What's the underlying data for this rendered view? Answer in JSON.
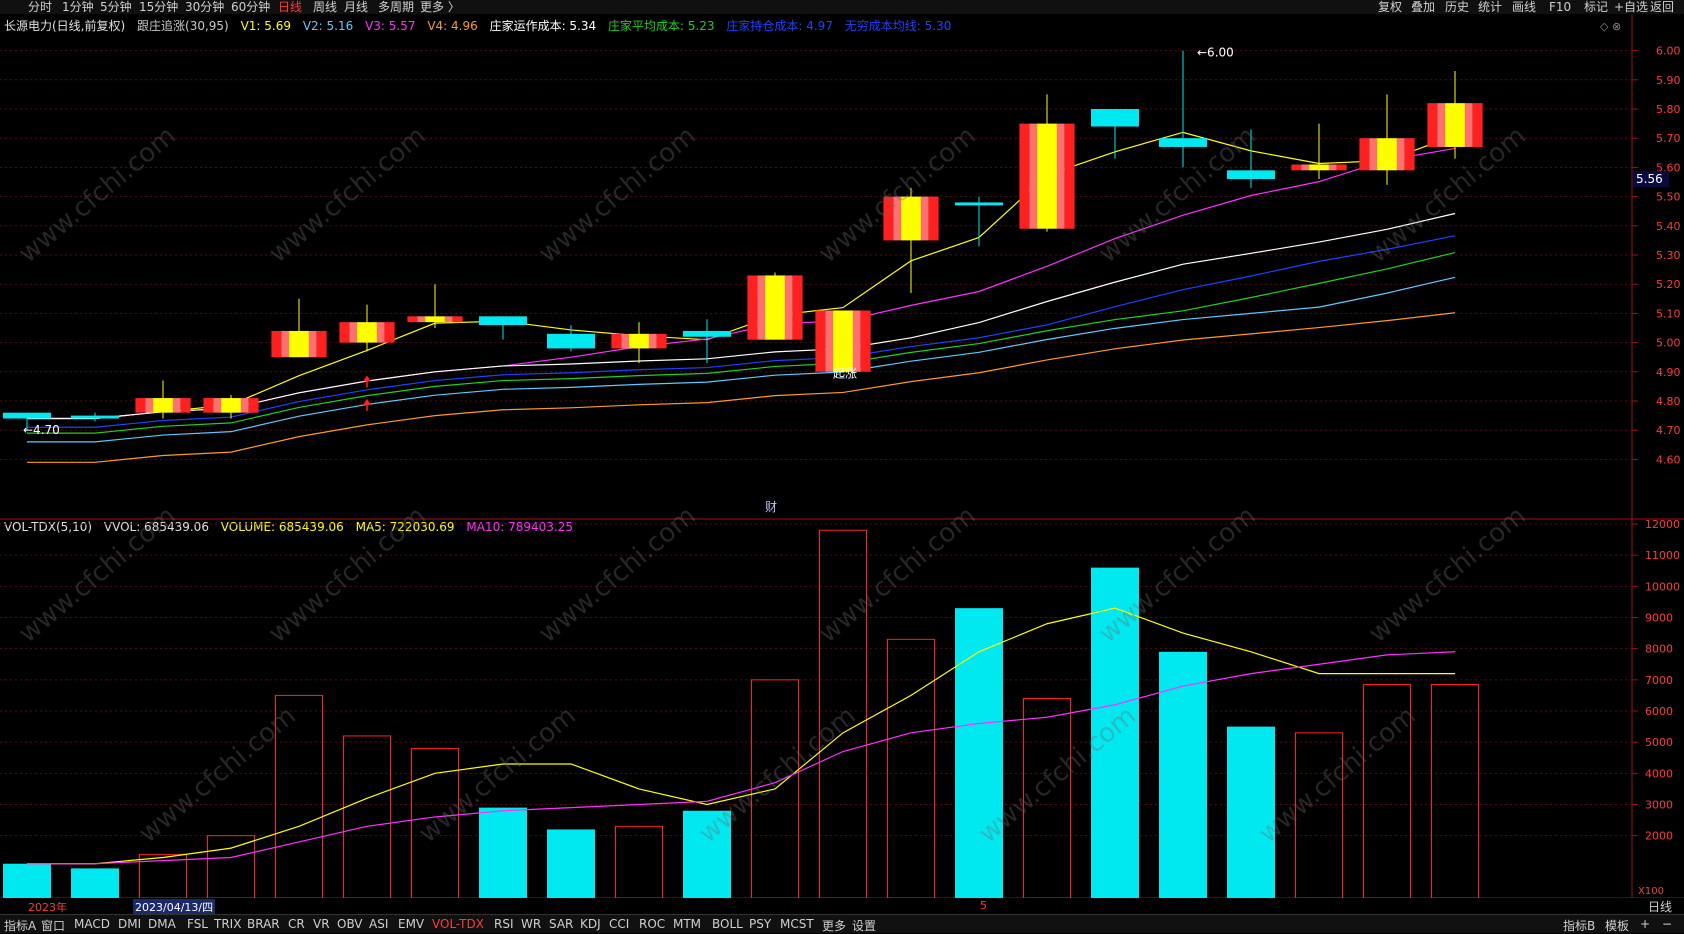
{
  "topbar": {
    "left_items": [
      "分时",
      "1分钟",
      "5分钟",
      "15分钟",
      "30分钟",
      "60分钟",
      "日线",
      "周线",
      "月线",
      "多周期",
      "更多 〉"
    ],
    "active": "日线",
    "right_items": [
      "复权",
      "叠加",
      "历史",
      "统计",
      "画线",
      "F10",
      "标记",
      "+自选",
      "返回"
    ]
  },
  "info": {
    "stock": "长源电力(日线,前复权)",
    "indicator": "跟庄追涨(30,95)",
    "v1": "V1: 5.69",
    "v2": "V2: 5.16",
    "v3": "V3: 5.57",
    "v4": "V4: 4.96",
    "cost": "庄家运作成本: 5.34",
    "avg": "庄家平均成本: 5.23",
    "hold": "庄家持仓成本: 4.97",
    "none": "无穷成本均线: 5.30"
  },
  "vinfo": {
    "name": "VOL-TDX(5,10)",
    "vvol": "VVOL: 685439.06",
    "volume": "VOLUME: 685439.06",
    "ma5": "MA5: 722030.69",
    "ma10": "MA10: 789403.25"
  },
  "colors": {
    "up": "#ff2020",
    "down": "#00e8f0",
    "yellow": "#ffff00",
    "magenta": "#ff30ff",
    "white": "#ffffff",
    "blue": "#2040ff",
    "green": "#20d020",
    "lightblue": "#60c8ff",
    "orange": "#ff9a20"
  },
  "price_axis": {
    "labels": [
      "6.00",
      "5.90",
      "5.80",
      "5.70",
      "5.60",
      "5.50",
      "5.40",
      "5.30",
      "5.20",
      "5.10",
      "5.00",
      "4.90",
      "4.80",
      "4.70",
      "4.60"
    ],
    "current": "5.56",
    "high_mark": "6.00",
    "low_mark": "4.70",
    "cai": "财",
    "ling_label": "起涨"
  },
  "volume_axis": {
    "labels": [
      "12000",
      "11000",
      "10000",
      "9000",
      "8000",
      "7000",
      "6000",
      "5000",
      "4000",
      "3000",
      "2000"
    ],
    "unit": "X100"
  },
  "dates": {
    "year": "2023年",
    "cursor": "2023/04/13/四",
    "month": "5"
  },
  "bottombar": {
    "items": [
      "指标A",
      "窗口",
      "MACD",
      "DMI",
      "DMA",
      "FSL",
      "TRIX",
      "BRAR",
      "CR",
      "VR",
      "OBV",
      "ASI",
      "EMV",
      "VOL-TDX",
      "RSI",
      "WR",
      "SAR",
      "KDJ",
      "CCI",
      "ROC",
      "MTM",
      "BOLL",
      "PSY",
      "MCST",
      "更多",
      "设置"
    ],
    "active": "VOL-TDX",
    "right_items": [
      "指标B",
      "模板",
      "+",
      "−"
    ],
    "right_tab": "日线"
  },
  "watermark": "www.cfchi.com",
  "chart_data": {
    "type": "candlestick",
    "candles": [
      {
        "o": 4.76,
        "c": 4.74,
        "h": 4.76,
        "l": 4.7,
        "vol": 1100
      },
      {
        "o": 4.75,
        "c": 4.74,
        "h": 4.76,
        "l": 4.73,
        "vol": 950
      },
      {
        "o": 4.76,
        "c": 4.81,
        "h": 4.87,
        "l": 4.74,
        "vol": 1400
      },
      {
        "o": 4.76,
        "c": 4.81,
        "h": 4.82,
        "l": 4.74,
        "vol": 2000
      },
      {
        "o": 4.95,
        "c": 5.04,
        "h": 5.15,
        "l": 4.95,
        "vol": 6500
      },
      {
        "o": 5.0,
        "c": 5.07,
        "h": 5.13,
        "l": 4.97,
        "vol": 5200
      },
      {
        "o": 5.07,
        "c": 5.09,
        "h": 5.2,
        "l": 5.05,
        "vol": 4800
      },
      {
        "o": 5.09,
        "c": 5.06,
        "h": 5.09,
        "l": 5.01,
        "vol": 2900
      },
      {
        "o": 5.03,
        "c": 4.98,
        "h": 5.06,
        "l": 4.97,
        "vol": 2200
      },
      {
        "o": 4.98,
        "c": 5.03,
        "h": 5.07,
        "l": 4.93,
        "vol": 2300
      },
      {
        "o": 5.04,
        "c": 5.02,
        "h": 5.08,
        "l": 4.93,
        "vol": 2800
      },
      {
        "o": 5.01,
        "c": 5.23,
        "h": 5.24,
        "l": 5.01,
        "vol": 7000
      },
      {
        "o": 4.9,
        "c": 5.11,
        "h": 5.11,
        "l": 4.9,
        "vol": 11800
      },
      {
        "o": 5.35,
        "c": 5.5,
        "h": 5.53,
        "l": 5.17,
        "vol": 8300
      },
      {
        "o": 5.48,
        "c": 5.47,
        "h": 5.5,
        "l": 5.33,
        "vol": 9300
      },
      {
        "o": 5.39,
        "c": 5.75,
        "h": 5.85,
        "l": 5.38,
        "vol": 6400
      },
      {
        "o": 5.8,
        "c": 5.74,
        "h": 5.8,
        "l": 5.63,
        "vol": 10600
      },
      {
        "o": 5.7,
        "c": 5.67,
        "h": 6.0,
        "l": 5.6,
        "vol": 7900
      },
      {
        "o": 5.59,
        "c": 5.56,
        "h": 5.73,
        "l": 5.53,
        "vol": 5500
      },
      {
        "o": 5.59,
        "c": 5.61,
        "h": 5.75,
        "l": 5.56,
        "vol": 5300
      },
      {
        "o": 5.59,
        "c": 5.7,
        "h": 5.85,
        "l": 5.54,
        "vol": 6850
      },
      {
        "o": 5.67,
        "c": 5.82,
        "h": 5.93,
        "l": 5.63,
        "vol": 6850
      }
    ],
    "ma5_vol": [
      1100,
      1100,
      1300,
      1600,
      2300,
      3200,
      4000,
      4300,
      4300,
      3500,
      3000,
      3500,
      5300,
      6500,
      7900,
      8800,
      9300,
      8500,
      7900,
      7200,
      7200,
      7200
    ],
    "ma10_vol": [
      1100,
      1100,
      1200,
      1300,
      1800,
      2300,
      2600,
      2800,
      2900,
      3000,
      3100,
      3700,
      4700,
      5300,
      5600,
      5800,
      6200,
      6800,
      7200,
      7500,
      7800,
      7900
    ],
    "ylim_price": [
      4.55,
      6.05
    ],
    "ylim_vol": [
      0,
      12000
    ]
  }
}
